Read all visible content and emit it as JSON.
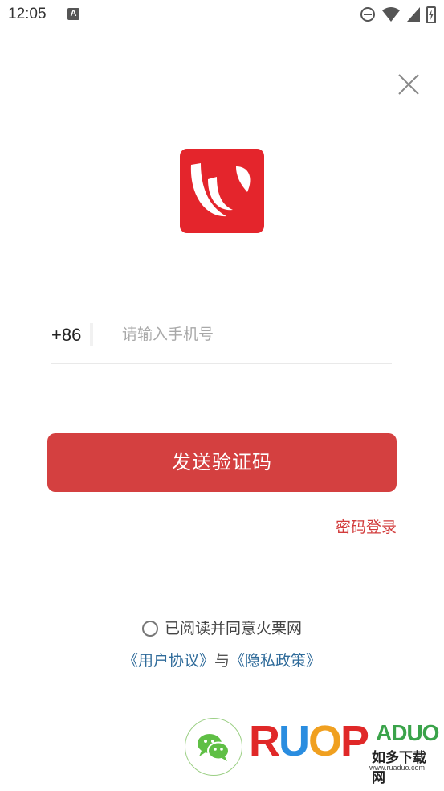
{
  "status_bar": {
    "time": "12:05",
    "notification_letter": "A",
    "icons": [
      "do-not-disturb-icon",
      "wifi-icon",
      "signal-icon",
      "battery-charging-icon"
    ]
  },
  "login": {
    "country_code": "+86",
    "phone_placeholder": "请输入手机号",
    "phone_value": "",
    "send_code_label": "发送验证码",
    "password_login_label": "密码登录"
  },
  "agreement": {
    "text": "已阅读并同意火栗网",
    "checked": false,
    "user_agreement": "《用户协议》",
    "connector": "与",
    "privacy_policy": "《隐私政策》"
  },
  "third_party": {
    "wechat_icon": "wechat-icon"
  },
  "watermark": {
    "brand_r": "R",
    "brand_u": "U",
    "brand_o": "O",
    "brand_p": "P",
    "brand_tail": "ADUO",
    "cn_text": "如多下载网",
    "url": "www.ruaduo.com"
  },
  "colors": {
    "accent": "#d44040",
    "logo_red": "#e4252c",
    "link_blue": "#2f6b9a",
    "wechat_green": "#5fbf45"
  }
}
